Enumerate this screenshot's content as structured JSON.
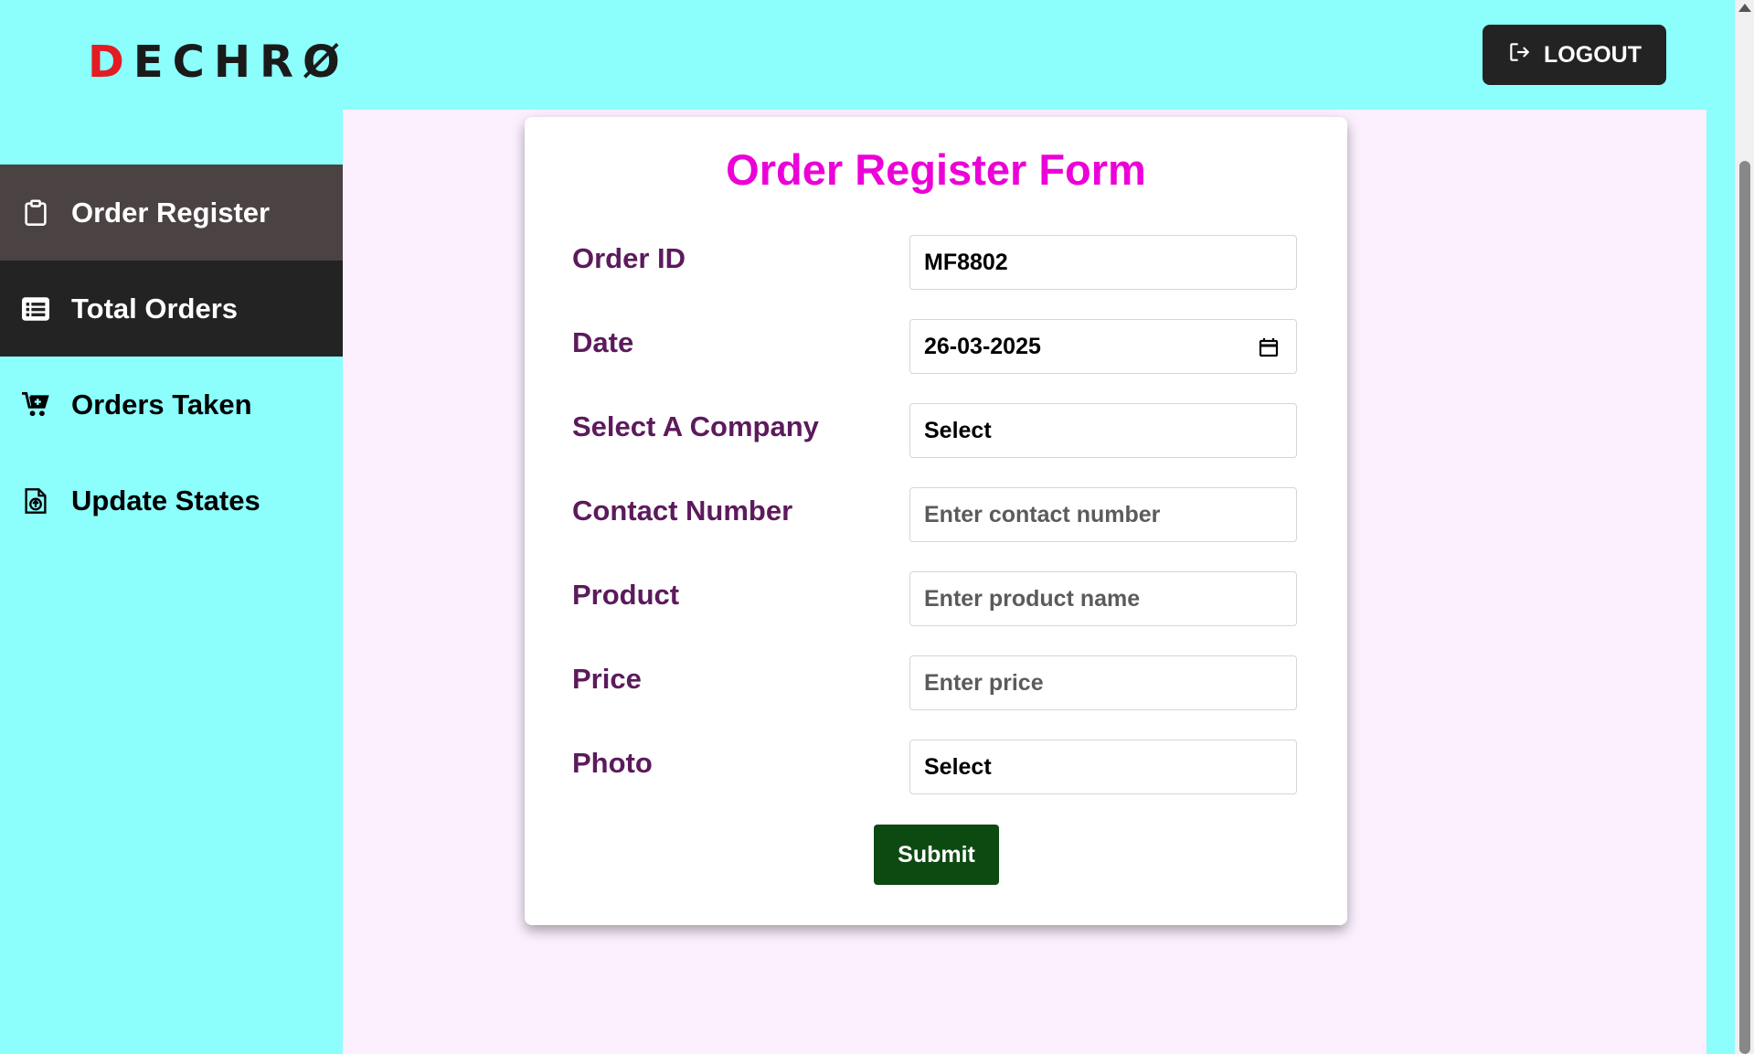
{
  "header": {
    "logo_text": "DECHRØ",
    "logo_first": "D",
    "logo_rest": "ECHR",
    "logo_last": "Ø",
    "logout_label": "LOGOUT"
  },
  "sidebar": {
    "items": [
      {
        "label": "Order Register",
        "icon": "clipboard-icon"
      },
      {
        "label": "Total Orders",
        "icon": "list-icon"
      },
      {
        "label": "Orders Taken",
        "icon": "cart-icon"
      },
      {
        "label": "Update States",
        "icon": "file-upload-icon"
      }
    ]
  },
  "form": {
    "title": "Order Register Form",
    "fields": [
      {
        "label": "Order ID",
        "value": "MF8802",
        "placeholder": ""
      },
      {
        "label": "Date",
        "value": "26-03-2025",
        "placeholder": ""
      },
      {
        "label": "Select A Company",
        "value": "Select",
        "placeholder": ""
      },
      {
        "label": "Contact Number",
        "value": "",
        "placeholder": "Enter contact number"
      },
      {
        "label": "Product",
        "value": "",
        "placeholder": "Enter product name"
      },
      {
        "label": "Price",
        "value": "",
        "placeholder": "Enter price"
      },
      {
        "label": "Photo",
        "value": "Select",
        "placeholder": ""
      }
    ],
    "submit_label": "Submit"
  },
  "colors": {
    "header_bg": "#8cfefc",
    "main_bg": "#fcf0fe",
    "title": "#ec00d8",
    "label": "#5c1a5c",
    "submit_bg": "#0d4a12",
    "active_item_bg": "#4b4343",
    "dark_item_bg": "#232323"
  }
}
